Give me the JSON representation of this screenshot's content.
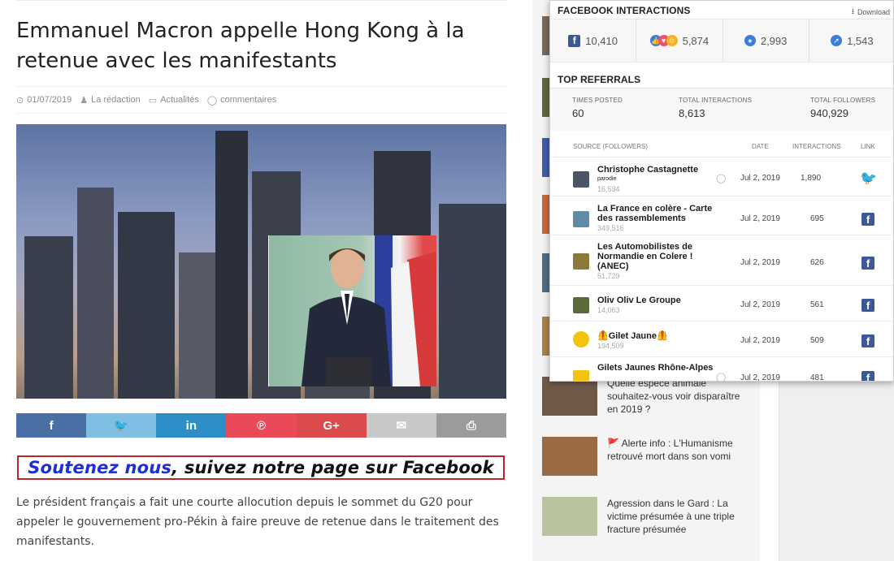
{
  "article": {
    "title": "Emmanuel Macron appelle Hong Kong à la retenue avec les manifestants",
    "date": "01/07/2019",
    "author": "La rédaction",
    "category": "Actualités",
    "comments": "commentaires",
    "share_colors": [
      "#4a6fa5",
      "#7fbfe3",
      "#2e8fc8",
      "#ea4a57",
      "#dc4b4b",
      "#c8c8c8",
      "#9b9b9b"
    ],
    "banner_highlight": "Soutenez nous",
    "banner_rest": ", suivez notre page sur Facebook",
    "body": "Le président français a fait une courte allocution depuis le sommet du G20 pour appeler le gouvernement pro-Pékin à faire preuve de retenue dans le traitement des manifestants."
  },
  "sidebar": {
    "items": [
      {
        "title": "Quelle espèce animale souhaitez-vous voir disparaître en 2019 ?"
      },
      {
        "title": "🚩 Alerte info : L'Humanisme retrouvé mort dans son vomi"
      },
      {
        "title": "Agression dans le Gard : La victime présumée à une triple fracture présumée"
      }
    ]
  },
  "panel": {
    "interactions_title": "FACEBOOK INTERACTIONS",
    "download_label": "Download",
    "stats": {
      "shares": "10,410",
      "reactions": "5,874",
      "comments": "2,993",
      "other": "1,543"
    },
    "referrals_title": "TOP REFERRALS",
    "summary": {
      "times_posted_label": "TIMES POSTED",
      "times_posted": "60",
      "total_interactions_label": "TOTAL INTERACTIONS",
      "total_interactions": "8,613",
      "total_followers_label": "TOTAL FOLLOWERS",
      "total_followers": "940,929"
    },
    "headers": {
      "source": "SOURCE (FOLLOWERS)",
      "date": "DATE",
      "interactions": "INTERACTIONS",
      "link": "LINK"
    },
    "rows": [
      {
        "name": "Christophe Castagnette",
        "sub": "parodie",
        "followers": "16,534",
        "date": "Jul 2, 2019",
        "interactions": "1,890",
        "link": "twitter"
      },
      {
        "name": "La France en colère - Carte des rassemblements",
        "followers": "349,516",
        "date": "Jul 2, 2019",
        "interactions": "695",
        "link": "facebook"
      },
      {
        "name": "Les Automobilistes de Normandie en Colere ! (ANEC)",
        "followers": "51,729",
        "date": "Jul 2, 2019",
        "interactions": "626",
        "link": "facebook"
      },
      {
        "name": "Oliv Oliv Le Groupe",
        "followers": "14,063",
        "date": "Jul 2, 2019",
        "interactions": "561",
        "link": "facebook"
      },
      {
        "name": "🦺Gilet Jaune🦺",
        "followers": "194,509",
        "date": "Jul 2, 2019",
        "interactions": "509",
        "link": "facebook"
      },
      {
        "name": "Gilets Jaunes Rhône-Alpes",
        "followers": "",
        "date": "Jul 2, 2019",
        "interactions": "481",
        "link": "facebook"
      }
    ]
  }
}
